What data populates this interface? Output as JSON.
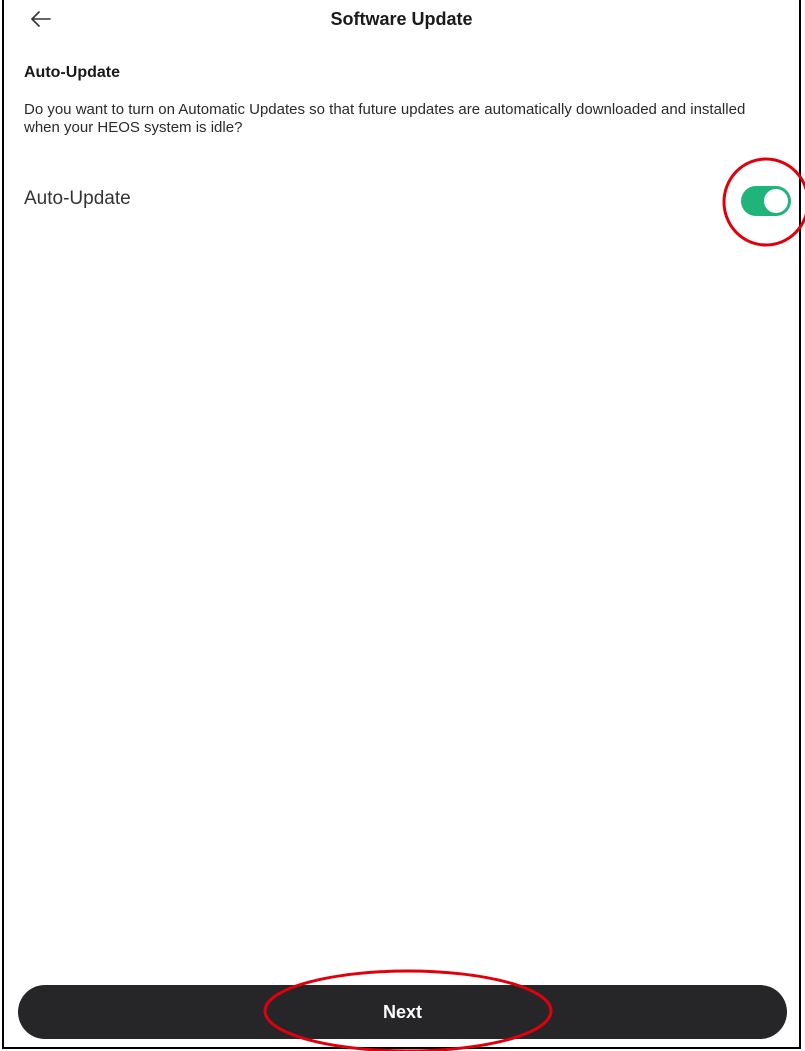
{
  "header": {
    "title": "Software Update",
    "back_icon": "arrow-left-icon"
  },
  "section": {
    "title": "Auto-Update",
    "description": "Do you want to turn on Automatic Updates so that future updates are automatically downloaded and installed when your HEOS system is idle?"
  },
  "setting": {
    "label": "Auto-Update",
    "enabled": true
  },
  "footer": {
    "next_label": "Next"
  },
  "colors": {
    "toggle_on": "#1fb57a",
    "button_bg": "#262629",
    "annotation": "#e0000c"
  }
}
